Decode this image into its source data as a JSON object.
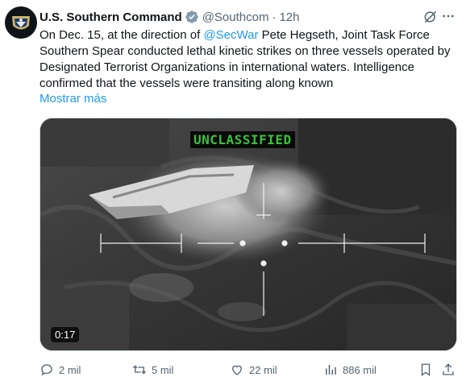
{
  "author": {
    "name": "U.S. Southern Command",
    "handle": "@Southcom",
    "separator": "·",
    "time": "12h"
  },
  "tweet": {
    "text_before_mention": "On Dec. 15, at the direction of ",
    "mention": "@SecWar",
    "text_after_mention": " Pete Hegseth, Joint Task Force Southern Spear conducted lethal kinetic strikes on three vessels operated by Designated Terrorist Organizations in international waters. Intelligence confirmed that the vessels were transiting along known",
    "show_more": "Mostrar más"
  },
  "media": {
    "overlay_label": "UNCLASSIFIED",
    "duration": "0:17"
  },
  "actions": {
    "replies": "2 mil",
    "reposts": "5 mil",
    "likes": "22 mil",
    "views": "886 mil"
  },
  "colors": {
    "accent": "#1d9bf0",
    "text": "#0f1419",
    "secondary": "#536471",
    "overlay_green": "#39c23a"
  },
  "icons": [
    "verified-badge-icon",
    "grok-icon",
    "more-options-icon",
    "reply-icon",
    "repost-icon",
    "like-icon",
    "views-icon",
    "bookmark-icon",
    "share-icon"
  ]
}
